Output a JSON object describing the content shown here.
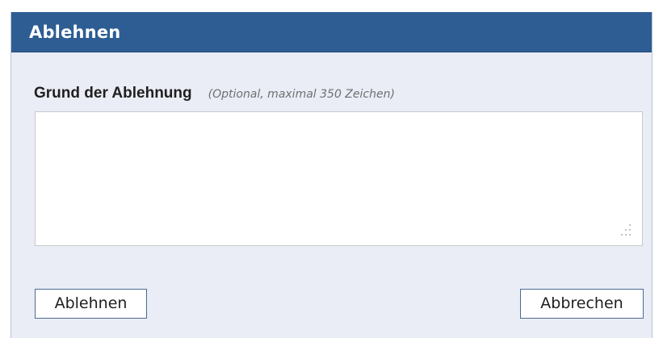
{
  "dialog": {
    "title": "Ablehnen",
    "field_label": "Grund der Ablehnung",
    "field_hint": "(Optional, maximal 350 Zeichen)",
    "textarea_value": "",
    "reject_button": "Ablehnen",
    "cancel_button": "Abbrechen"
  },
  "colors": {
    "titlebar": "#2d5d93",
    "body": "#eaedf6",
    "button_border": "#4a6a93"
  },
  "icons": {
    "resize_grip": "resize-grip-icon"
  }
}
